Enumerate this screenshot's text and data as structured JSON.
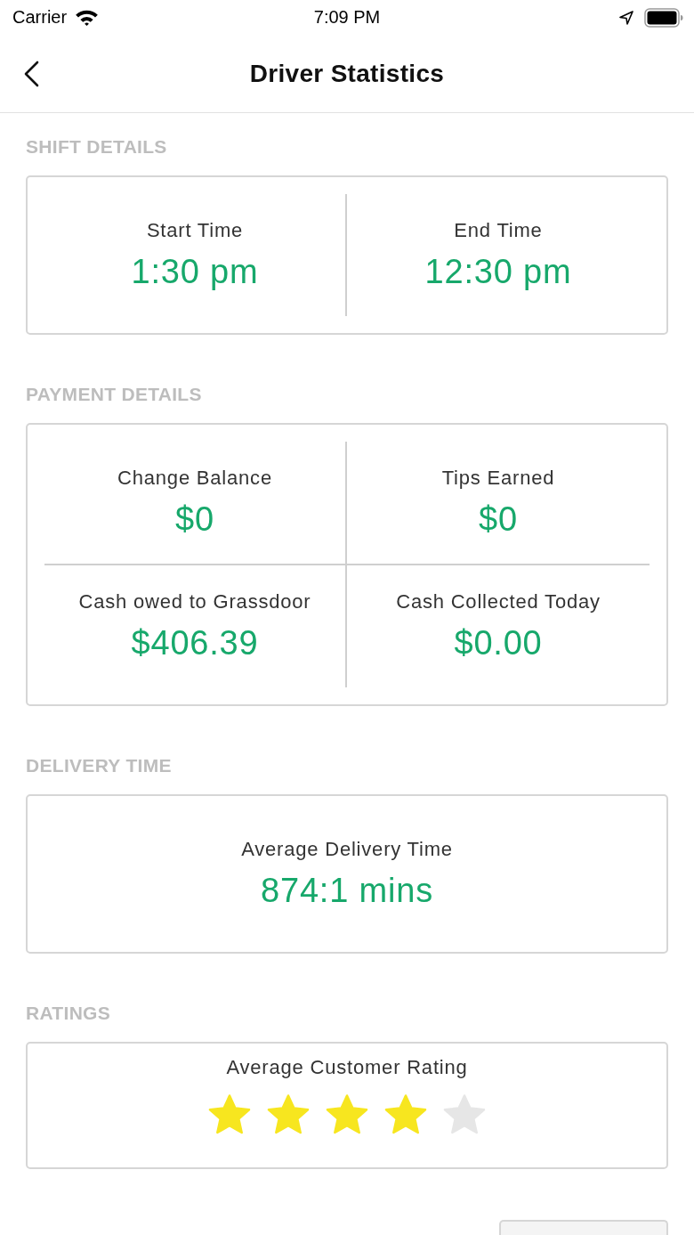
{
  "status_bar": {
    "carrier": "Carrier",
    "time": "7:09 PM"
  },
  "nav": {
    "title": "Driver Statistics"
  },
  "sections": [
    {
      "heading": "SHIFT DETAILS",
      "kind": "stats",
      "cells": [
        {
          "label": "Start Time",
          "value": "1:30 pm"
        },
        {
          "label": "End Time",
          "value": "12:30 pm"
        }
      ]
    },
    {
      "heading": "PAYMENT DETAILS",
      "kind": "stats",
      "cells": [
        {
          "label": "Change Balance",
          "value": "$0"
        },
        {
          "label": "Tips Earned",
          "value": "$0"
        },
        {
          "label": "Cash owed to Grassdoor",
          "value": "$406.39"
        },
        {
          "label": "Cash Collected Today",
          "value": "$0.00"
        }
      ]
    },
    {
      "heading": "DELIVERY TIME",
      "kind": "stats",
      "cells": [
        {
          "label": "Average Delivery Time",
          "value": "874:1 mins"
        }
      ]
    },
    {
      "heading": "RATINGS",
      "kind": "rating",
      "label": "Average Customer Rating",
      "stars": 4
    }
  ]
}
